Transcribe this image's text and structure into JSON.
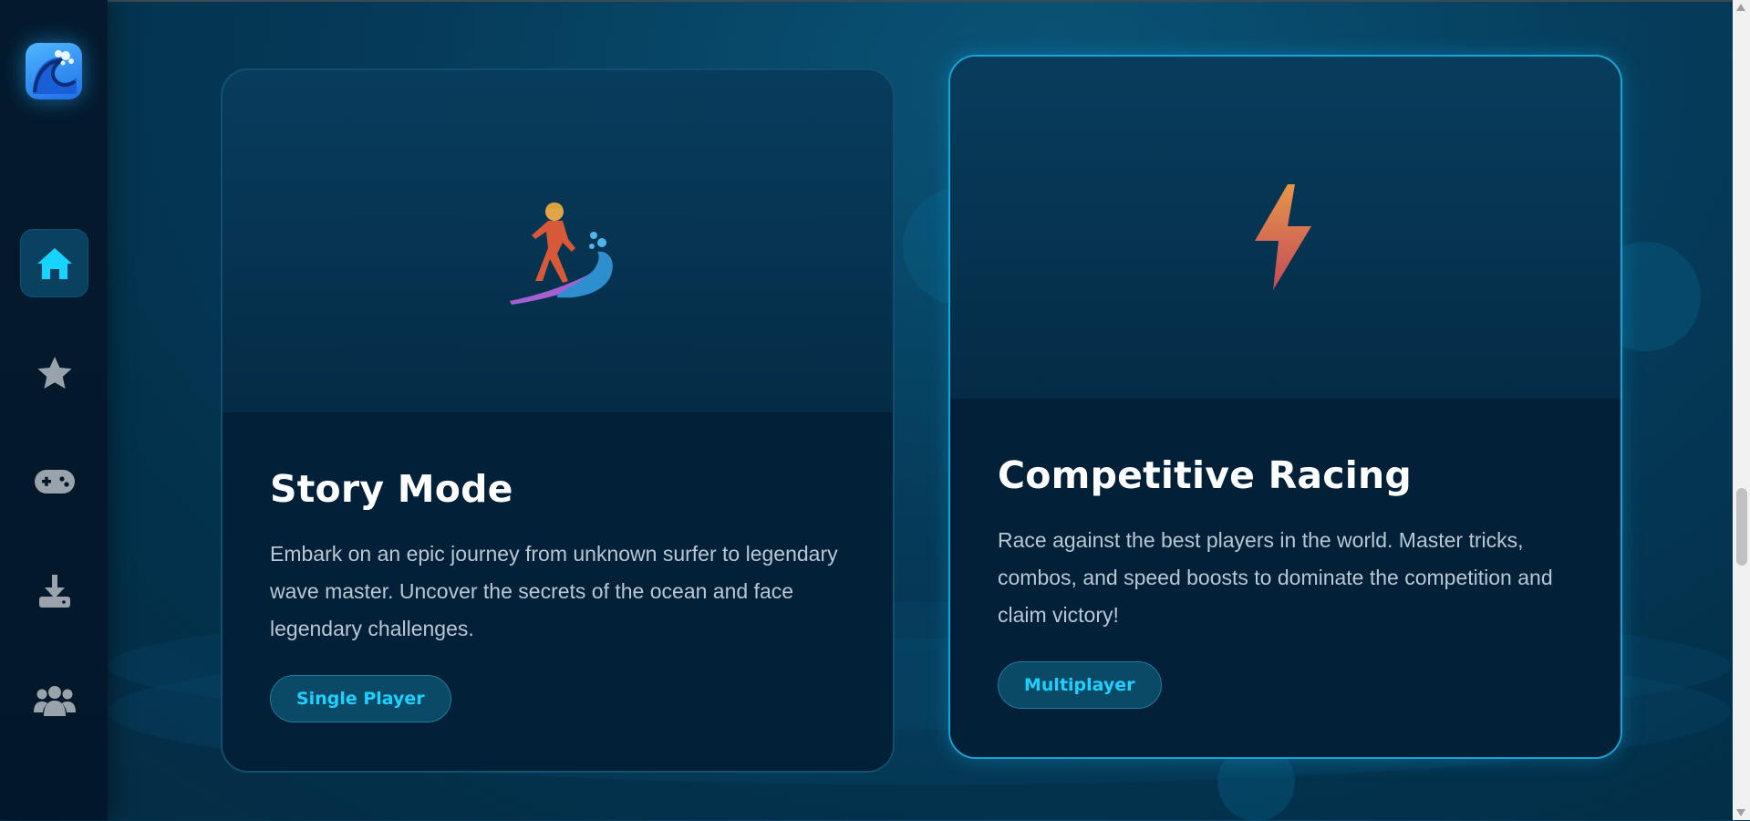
{
  "sidebar": {
    "logo_icon": "wave-logo-icon",
    "items": [
      {
        "icon": "home-icon",
        "active": true
      },
      {
        "icon": "star-icon",
        "active": false
      },
      {
        "icon": "gamepad-icon",
        "active": false
      },
      {
        "icon": "download-icon",
        "active": false
      },
      {
        "icon": "users-icon",
        "active": false
      }
    ]
  },
  "cards": [
    {
      "icon": "surfer-icon",
      "title": "Story Mode",
      "description": "Embark on an epic journey from unknown surfer to legendary wave master. Uncover the secrets of the ocean and face legendary challenges.",
      "button_label": "Single Player"
    },
    {
      "icon": "lightning-icon",
      "title": "Competitive Racing",
      "description": "Race against the best players in the world. Master tricks, combos, and speed boosts to dominate the competition and claim victory!",
      "button_label": "Multiplayer"
    }
  ],
  "colors": {
    "accent": "#1fd0ff",
    "background": "#053a58",
    "sidebar": "#03172a",
    "highlight_border": "#19a4d6"
  }
}
